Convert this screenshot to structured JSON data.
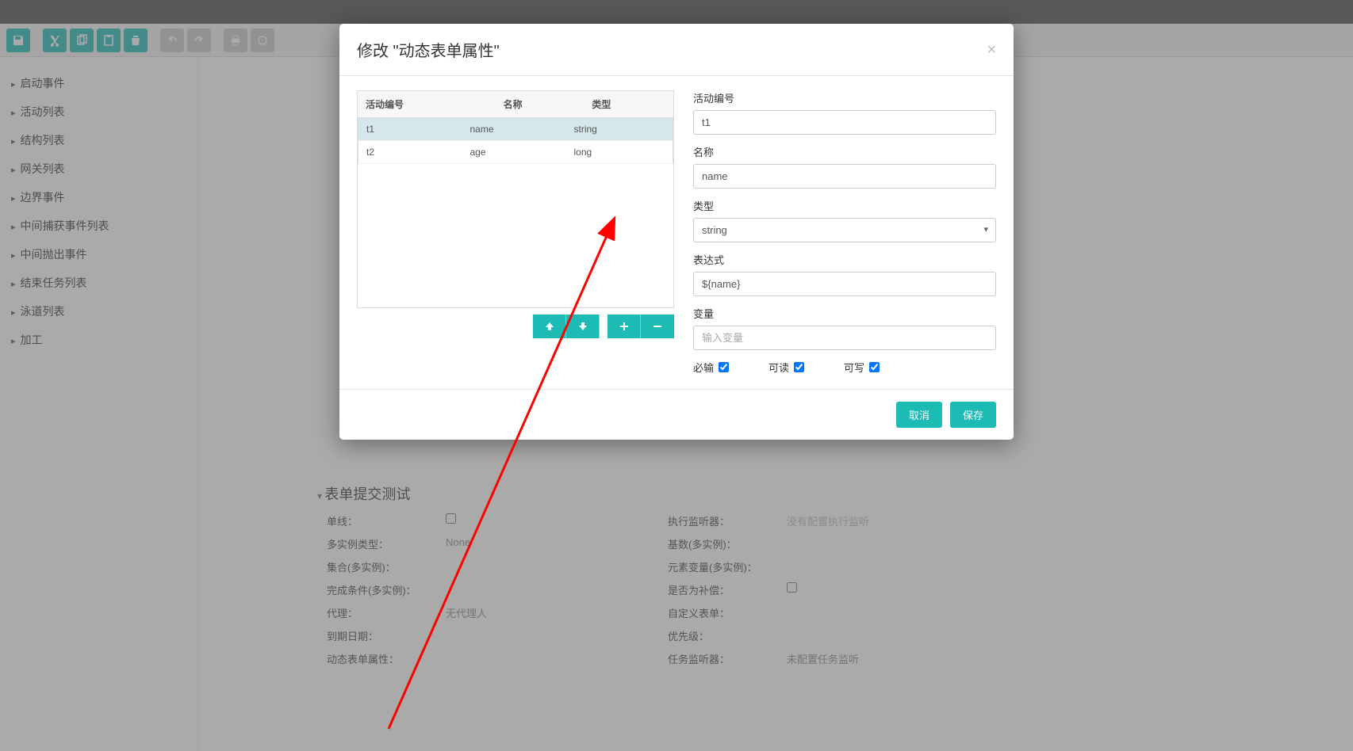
{
  "toolbar_icons": [
    "save",
    "cut",
    "copy",
    "paste",
    "delete",
    "undo",
    "redo",
    "print",
    "extra"
  ],
  "sidebar": {
    "items": [
      {
        "label": "启动事件"
      },
      {
        "label": "活动列表"
      },
      {
        "label": "结构列表"
      },
      {
        "label": "网关列表"
      },
      {
        "label": "边界事件"
      },
      {
        "label": "中间捕获事件列表"
      },
      {
        "label": "中间抛出事件"
      },
      {
        "label": "结束任务列表"
      },
      {
        "label": "泳道列表"
      },
      {
        "label": "加工"
      }
    ]
  },
  "modal": {
    "title": "修改 \"动态表单属性\"",
    "table": {
      "headers": [
        "活动编号",
        "名称",
        "类型"
      ],
      "rows": [
        {
          "id": "t1",
          "name": "name",
          "type": "string",
          "selected": true
        },
        {
          "id": "t2",
          "name": "age",
          "type": "long",
          "selected": false
        }
      ]
    },
    "form": {
      "id_label": "活动编号",
      "id_value": "t1",
      "name_label": "名称",
      "name_value": "name",
      "type_label": "类型",
      "type_value": "string",
      "expr_label": "表达式",
      "expr_value": "${name}",
      "var_label": "变量",
      "var_placeholder": "输入变量",
      "required_label": "必输",
      "readable_label": "可读",
      "writable_label": "可写"
    },
    "footer": {
      "cancel": "取消",
      "save": "保存"
    }
  },
  "panel": {
    "title": "表单提交测试",
    "rows": [
      {
        "l1": "单线：",
        "v1": "",
        "l2": "执行监听器：",
        "v2": "没有配置执行监听"
      },
      {
        "l1": "多实例类型：",
        "v1": "None",
        "l2": "基数(多实例)：",
        "v2": ""
      },
      {
        "l1": "集合(多实例)：",
        "v1": "",
        "l2": "元素变量(多实例)：",
        "v2": ""
      },
      {
        "l1": "完成条件(多实例)：",
        "v1": "",
        "l2": "是否为补偿：",
        "v2": ""
      },
      {
        "l1": "代理：",
        "v1": "无代理人",
        "l2": "自定义表单：",
        "v2": ""
      },
      {
        "l1": "到期日期：",
        "v1": "",
        "l2": "优先级：",
        "v2": ""
      },
      {
        "l1": "动态表单属性：",
        "v1": "",
        "l2": "任务监听器：",
        "v2": "未配置任务监听"
      }
    ]
  }
}
